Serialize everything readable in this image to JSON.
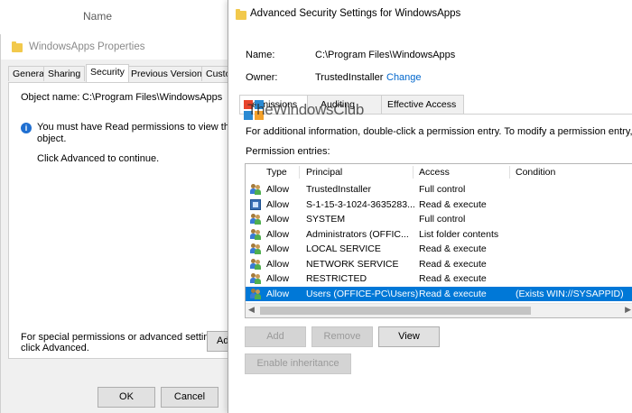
{
  "explorer": {
    "column_header": "Name"
  },
  "properties": {
    "title": "WindowsApps Properties",
    "tabs": [
      "General",
      "Sharing",
      "Security",
      "Previous Versions",
      "Custo"
    ],
    "object_name_label": "Object name:",
    "object_name_value": "C:\\Program Files\\WindowsApps",
    "info_message_1": "You must have Read permissions to view the prope",
    "info_message_2": "object.",
    "click_advanced": "Click Advanced to continue.",
    "special_permissions_1": "For special permissions or advanced settings,",
    "special_permissions_2": "click Advanced.",
    "advanced_button": "Adv",
    "ok_button": "OK",
    "cancel_button": "Cancel"
  },
  "advanced": {
    "title": "Advanced Security Settings for WindowsApps",
    "name_label": "Name:",
    "name_value": "C:\\Program Files\\WindowsApps",
    "owner_label": "Owner:",
    "owner_value": "TrustedInstaller",
    "change_link": "Change",
    "tabs": [
      "Permissions",
      "Auditing",
      "Effective Access"
    ],
    "instructions": "For additional information, double-click a permission entry. To modify a permission entry, sel",
    "entries_label": "Permission entries:",
    "columns": [
      "Type",
      "Principal",
      "Access",
      "Condition"
    ],
    "rows": [
      {
        "type": "Allow",
        "principal": "TrustedInstaller",
        "access": "Full control",
        "condition": "",
        "icon": "users-icon"
      },
      {
        "type": "Allow",
        "principal": "S-1-15-3-1024-3635283...",
        "access": "Read & execute",
        "condition": "",
        "icon": "package-icon"
      },
      {
        "type": "Allow",
        "principal": "SYSTEM",
        "access": "Full control",
        "condition": "",
        "icon": "users-icon"
      },
      {
        "type": "Allow",
        "principal": "Administrators (OFFIC...",
        "access": "List folder contents",
        "condition": "",
        "icon": "users-icon"
      },
      {
        "type": "Allow",
        "principal": "LOCAL SERVICE",
        "access": "Read & execute",
        "condition": "",
        "icon": "users-icon"
      },
      {
        "type": "Allow",
        "principal": "NETWORK SERVICE",
        "access": "Read & execute",
        "condition": "",
        "icon": "users-icon"
      },
      {
        "type": "Allow",
        "principal": "RESTRICTED",
        "access": "Read & execute",
        "condition": "",
        "icon": "users-icon"
      },
      {
        "type": "Allow",
        "principal": "Users (OFFICE-PC\\Users)",
        "access": "Read & execute",
        "condition": "(Exists WIN://SYSAPPID)",
        "icon": "users-icon",
        "selected": true
      }
    ],
    "add_button": "Add",
    "remove_button": "Remove",
    "view_button": "View",
    "enable_inheritance_button": "Enable inheritance"
  },
  "watermark": {
    "text": "TheWindowsClub"
  },
  "colors": {
    "selection": "#0078d7",
    "link": "#0066cc",
    "folder": "#f2c94c"
  }
}
